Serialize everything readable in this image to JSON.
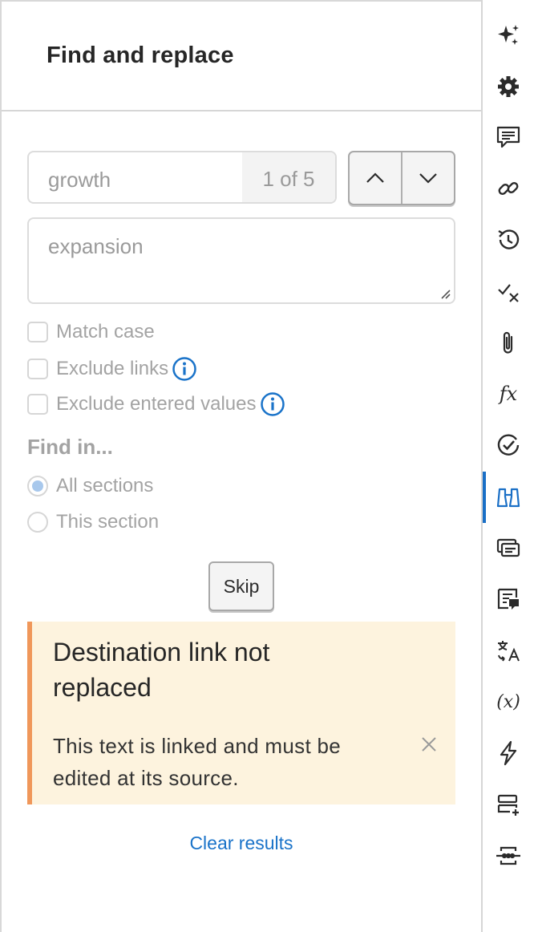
{
  "panel": {
    "title": "Find and replace",
    "find_value": "growth",
    "match_count": "1 of 5",
    "replace_value": "expansion",
    "options": [
      {
        "label": "Match case",
        "checked": false,
        "info": false
      },
      {
        "label": "Exclude links",
        "checked": false,
        "info": true
      },
      {
        "label": "Exclude entered values",
        "checked": false,
        "info": true
      }
    ],
    "find_in_label": "Find in...",
    "scopes": [
      {
        "label": "All sections",
        "selected": true
      },
      {
        "label": "This section",
        "selected": false
      }
    ],
    "skip_label": "Skip",
    "alert": {
      "title": "Destination link not replaced",
      "text_line1": "This text is linked and must be",
      "text_line2": "edited at its source.",
      "accent_color": "#f0975a",
      "background": "#fdf3de"
    },
    "clear_label": "Clear results"
  },
  "rail": {
    "items": [
      {
        "icon": "sparkle-icon"
      },
      {
        "icon": "gear-icon"
      },
      {
        "icon": "comment-icon"
      },
      {
        "icon": "link-icon"
      },
      {
        "icon": "history-icon"
      },
      {
        "icon": "check-cross-icon"
      },
      {
        "icon": "paperclip-icon"
      },
      {
        "icon": "function-icon",
        "text": "fx"
      },
      {
        "icon": "check-circle-icon"
      },
      {
        "icon": "binoculars-icon",
        "active": true
      },
      {
        "icon": "cards-icon"
      },
      {
        "icon": "note-comment-icon"
      },
      {
        "icon": "translate-icon"
      },
      {
        "icon": "variable-icon",
        "text": "(x)"
      },
      {
        "icon": "lightning-icon"
      },
      {
        "icon": "add-row-icon"
      },
      {
        "icon": "connector-icon"
      }
    ],
    "active_color": "#1a6fc6"
  },
  "colors": {
    "link": "#1a73c9",
    "info": "#1a73c9"
  }
}
